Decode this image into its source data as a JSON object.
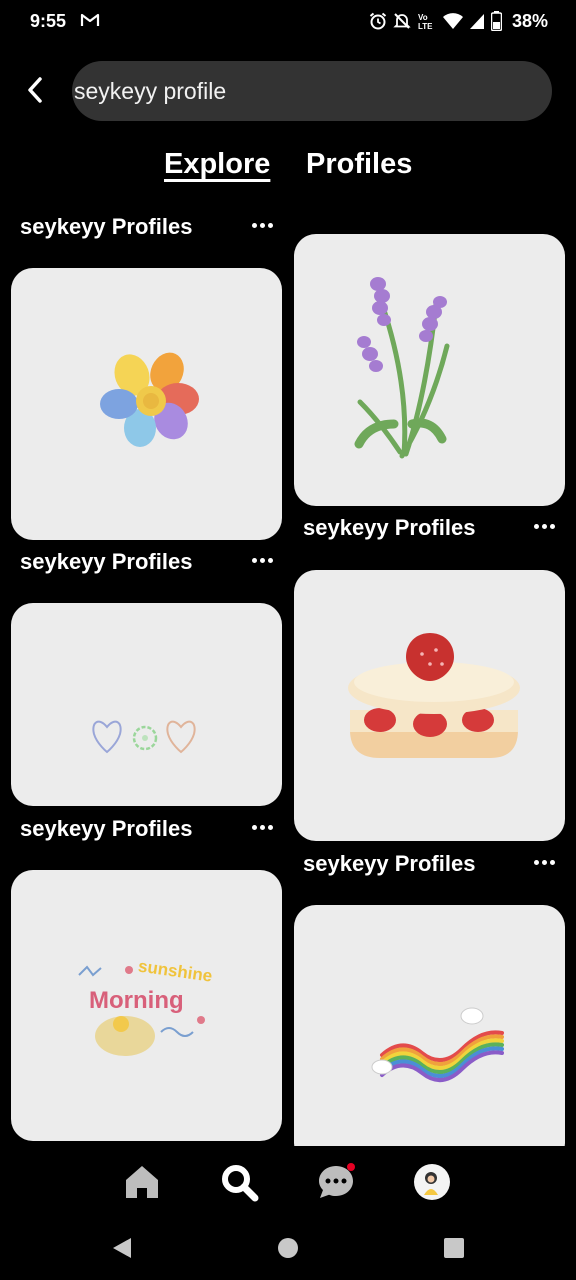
{
  "status_bar": {
    "time": "9:55",
    "battery": "38%",
    "icons": [
      "gmail-icon",
      "alarm-icon",
      "mute-icon",
      "volte-icon",
      "wifi-icon",
      "signal-icon",
      "battery-icon"
    ]
  },
  "search": {
    "value": "seykeyy profile"
  },
  "tabs": [
    {
      "label": "Explore",
      "active": true
    },
    {
      "label": "Profiles",
      "active": false
    }
  ],
  "pins": [
    {
      "caption": "seykeyy Profiles",
      "image": "rainbow-flower"
    },
    {
      "caption": "seykeyy Profiles",
      "image": "lavender"
    },
    {
      "caption": "seykeyy Profiles",
      "image": "hearts-and-flower"
    },
    {
      "caption": "seykeyy Profiles",
      "image": "strawberry-cake"
    },
    {
      "caption": "seykeyy Profiles",
      "image": "sunshine-morning"
    },
    {
      "caption": "",
      "image": "rainbow-ribbon"
    }
  ],
  "sunshine_morning_art": {
    "line1": "sunshine",
    "line2": "Morning"
  },
  "bottom_nav": [
    "home-icon",
    "search-icon",
    "messages-icon",
    "profile-avatar"
  ],
  "colors": {
    "background": "#000000",
    "search_bg": "#333333",
    "card_bg": "#ececec",
    "notification": "#e60023"
  }
}
